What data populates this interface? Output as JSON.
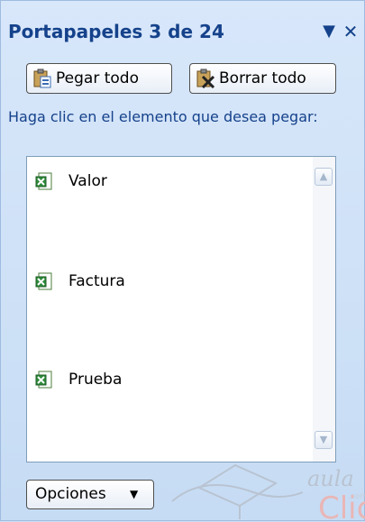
{
  "panel": {
    "title": "Portapapeles 3 de 24",
    "menu_icon": "dropdown-arrow-icon",
    "close_icon": "close-icon"
  },
  "toolbar": {
    "paste_all_label": "Pegar todo",
    "clear_all_label": "Borrar todo"
  },
  "instruction": "Haga clic en el elemento que desea pegar:",
  "items": [
    {
      "label": "Valor",
      "icon": "excel-icon"
    },
    {
      "label": "Factura",
      "icon": "excel-icon"
    },
    {
      "label": "Prueba",
      "icon": "excel-icon"
    }
  ],
  "footer": {
    "options_label": "Opciones",
    "watermark_text": "aula Clic .com"
  },
  "colors": {
    "title_text": "#15428b",
    "pane_background": "#d8e7fa",
    "list_border": "#7f9db9"
  }
}
